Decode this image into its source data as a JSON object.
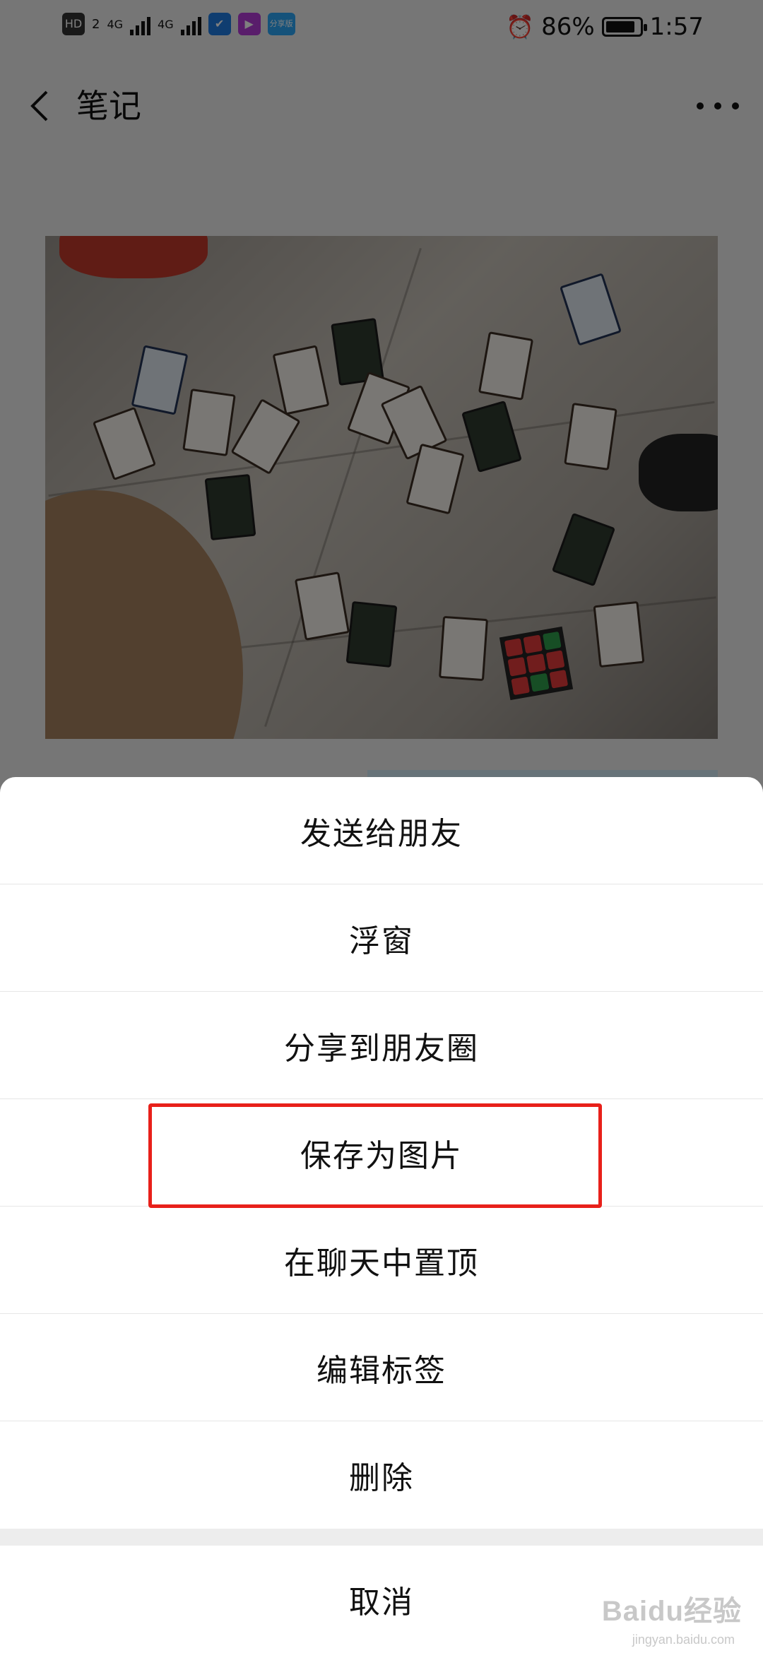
{
  "status_bar": {
    "left_badges": [
      "HD",
      "2",
      "4G",
      "4G"
    ],
    "app_icons": [
      "shield-app-icon",
      "video-app-icon",
      "blue-app-icon"
    ],
    "blue_app_text": "分享版",
    "battery_percent": "86%",
    "battery_level": 0.86,
    "time": "1:57",
    "alarm_icon": "alarm-icon"
  },
  "nav": {
    "back_icon": "chevron-left-icon",
    "title": "笔记",
    "more_icon": "more-dots-icon"
  },
  "note": {
    "image_description_icon": "photo-image"
  },
  "action_sheet": {
    "items": [
      {
        "label": "发送给朋友"
      },
      {
        "label": "浮窗"
      },
      {
        "label": "分享到朋友圈"
      },
      {
        "label": "保存为图片",
        "highlighted": true
      },
      {
        "label": "在聊天中置顶"
      },
      {
        "label": "编辑标签"
      },
      {
        "label": "删除"
      }
    ],
    "cancel_label": "取消"
  },
  "colors": {
    "highlight_border": "#e8201a",
    "sheet_background": "#ffffff",
    "overlay": "rgba(0,0,0,0.5)"
  },
  "watermark": {
    "text": "Baidu经验",
    "sub": "jingyan.baidu.com"
  }
}
